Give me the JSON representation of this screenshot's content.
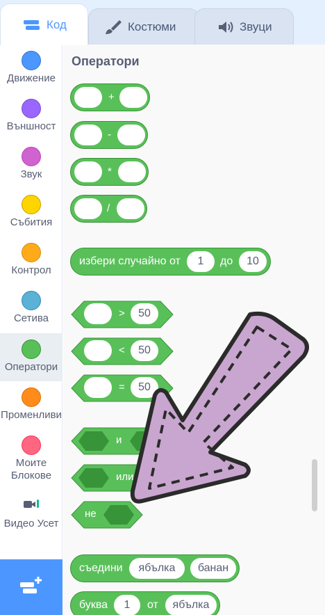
{
  "tabs": [
    {
      "label": "Код",
      "icon": "code-icon",
      "active": true
    },
    {
      "label": "Костюми",
      "icon": "brush-icon",
      "active": false
    },
    {
      "label": "Звуци",
      "icon": "speaker-icon",
      "active": false
    }
  ],
  "categories": [
    {
      "label": "Движение",
      "color": "#4c97ff"
    },
    {
      "label": "Външност",
      "color": "#9966ff"
    },
    {
      "label": "Звук",
      "color": "#cf63cf"
    },
    {
      "label": "Събития",
      "color": "#ffd500"
    },
    {
      "label": "Контрол",
      "color": "#ffab19"
    },
    {
      "label": "Сетива",
      "color": "#5cb1d6"
    },
    {
      "label": "Оператори",
      "color": "#59c059"
    },
    {
      "label": "Променливи",
      "color": "#ff8c1a"
    },
    {
      "label": "Моите Блокове",
      "color": "#ff6680"
    },
    {
      "label": "Видео Усет",
      "color": "#0fbd8c"
    }
  ],
  "palette": {
    "title": "Оператори",
    "arith_ops": [
      "+",
      "-",
      "*",
      "/"
    ],
    "random": {
      "text1": "избери случайно от",
      "from": "1",
      "text2": "до",
      "to": "10"
    },
    "compare": [
      {
        "op": ">",
        "value": "50"
      },
      {
        "op": "<",
        "value": "50"
      },
      {
        "op": "=",
        "value": "50"
      }
    ],
    "logic": {
      "and": "и",
      "or": "или",
      "not": "не"
    },
    "join": {
      "text": "съедини",
      "a": "ябълка",
      "b": "банан"
    },
    "letter": {
      "text": "буква",
      "index": "1",
      "of": "от",
      "word": "ябълка"
    }
  },
  "colors": {
    "operators": "#59c059",
    "accent": "#4c97ff",
    "overlay_arrow": "#c9a6cf"
  }
}
